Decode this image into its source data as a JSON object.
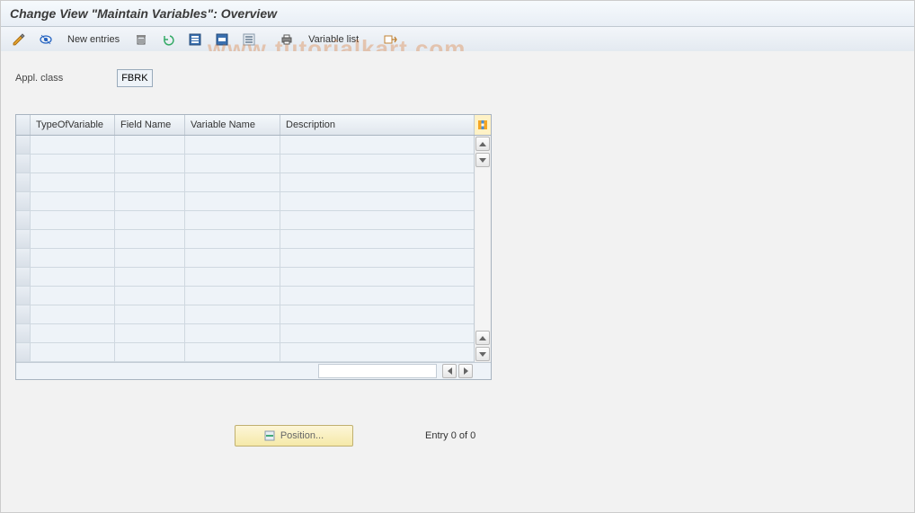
{
  "title": "Change View \"Maintain Variables\": Overview",
  "toolbar": {
    "new_entries_label": "New entries",
    "variable_list_label": "Variable list"
  },
  "field": {
    "appl_class_label": "Appl. class",
    "appl_class_value": "FBRK"
  },
  "table": {
    "columns": {
      "type_of_variable": "TypeOfVariable",
      "field_name": "Field Name",
      "variable_name": "Variable Name",
      "description": "Description"
    },
    "row_count": 12
  },
  "footer": {
    "position_label": "Position...",
    "entry_text": "Entry 0 of 0"
  },
  "watermark": "tutorialkart.com"
}
